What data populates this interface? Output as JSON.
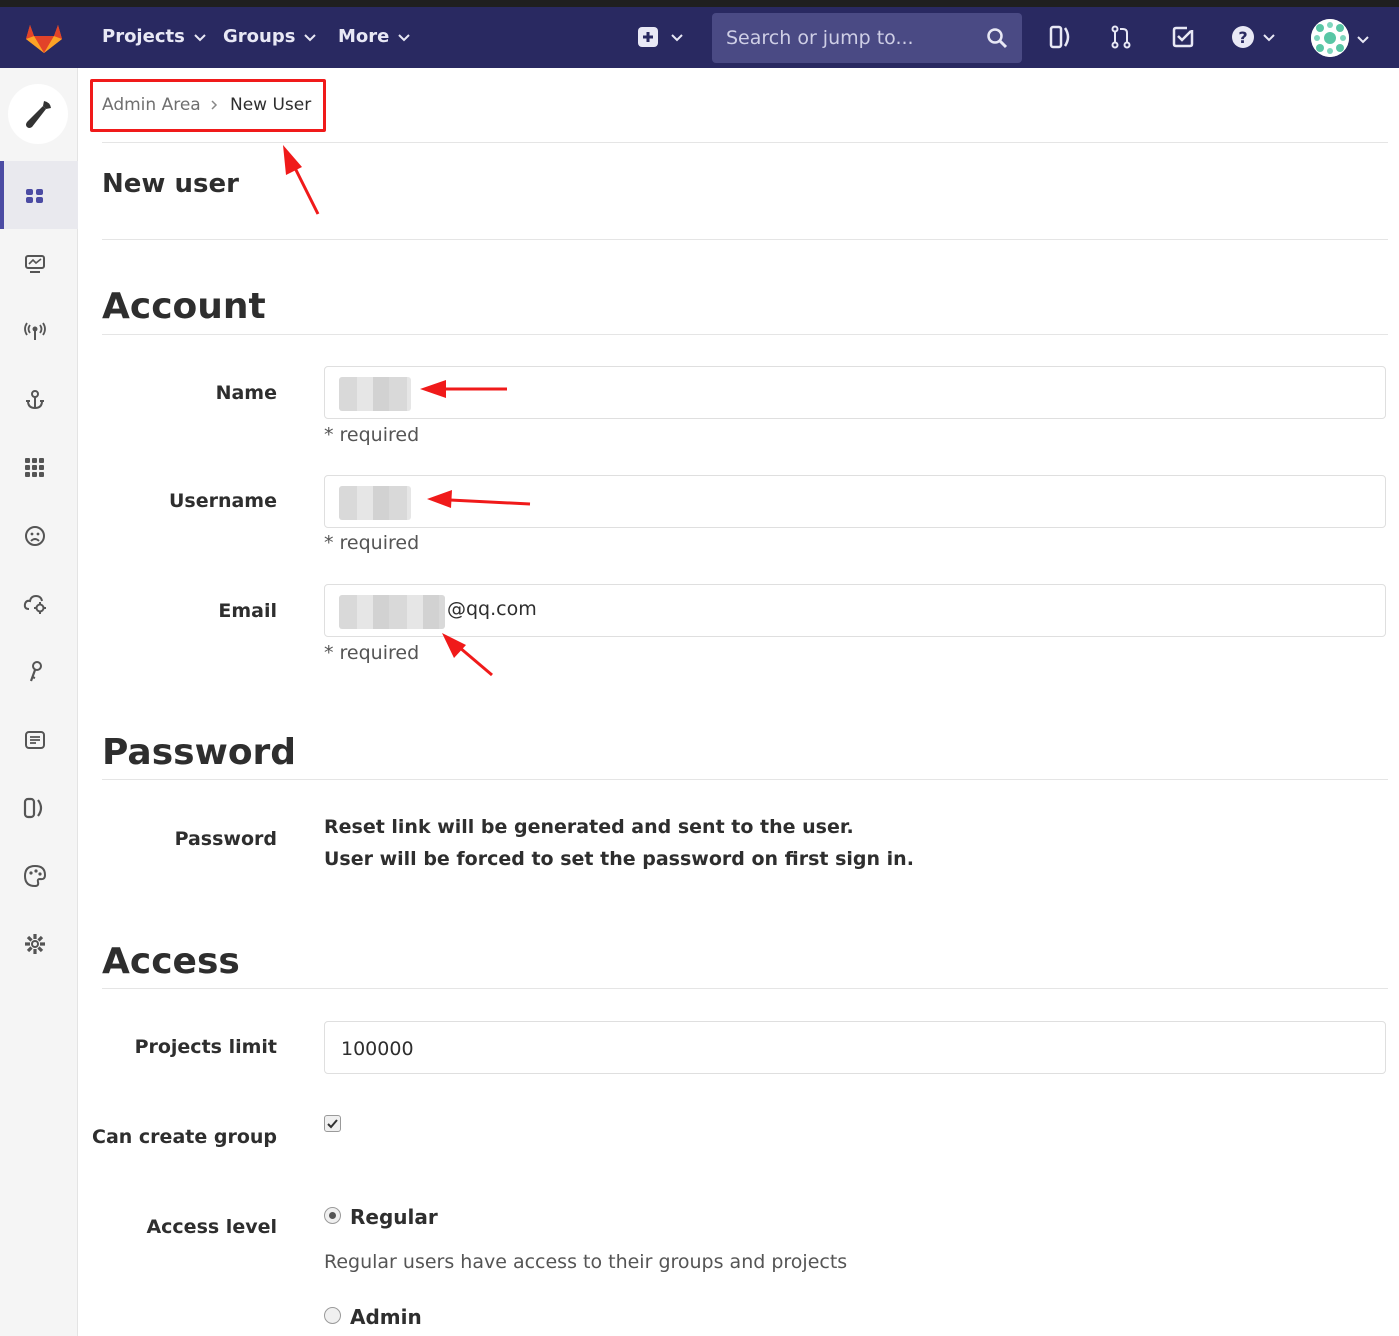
{
  "navbar": {
    "projects_label": "Projects",
    "groups_label": "Groups",
    "more_label": "More",
    "search_placeholder": "Search or jump to..."
  },
  "breadcrumb": {
    "root": "Admin Area",
    "current": "New User"
  },
  "page": {
    "title": "New user"
  },
  "account": {
    "title": "Account",
    "name_label": "Name",
    "username_label": "Username",
    "email_label": "Email",
    "email_suffix": "@qq.com",
    "required_text": "* required"
  },
  "password": {
    "title": "Password",
    "label": "Password",
    "line1": "Reset link will be generated and sent to the user.",
    "line2": "User will be forced to set the password on first sign in."
  },
  "access": {
    "title": "Access",
    "projects_limit_label": "Projects limit",
    "projects_limit_value": "100000",
    "can_create_group_label": "Can create group",
    "can_create_group_checked": true,
    "access_level_label": "Access level",
    "regular_label": "Regular",
    "regular_help": "Regular users have access to their groups and projects",
    "admin_label": "Admin",
    "selected_level": "Regular"
  },
  "colors": {
    "navbar": "#292961",
    "annotation": "#f01a1a",
    "sidebar_active": "#4b4ba3"
  }
}
